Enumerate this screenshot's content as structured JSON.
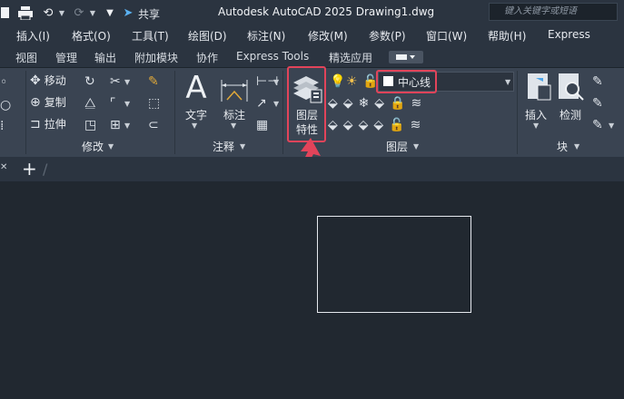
{
  "titlebar": {
    "share_label": "共享",
    "title": "Autodesk AutoCAD 2025    Drawing1.dwg",
    "search_placeholder": "键入关键字或短语"
  },
  "menubar": {
    "items": [
      "插入(I)",
      "格式(O)",
      "工具(T)",
      "绘图(D)",
      "标注(N)",
      "修改(M)",
      "参数(P)",
      "窗口(W)",
      "帮助(H)",
      "Express"
    ]
  },
  "ribbon_tabs": [
    "视图",
    "管理",
    "输出",
    "附加模块",
    "协作",
    "Express Tools",
    "精选应用"
  ],
  "modify_group": {
    "move": "移动",
    "copy": "复制",
    "stretch": "拉伸",
    "title": "修改"
  },
  "annotation_group": {
    "text": "文字",
    "dimension": "标注",
    "title": "注释"
  },
  "layers_group": {
    "layer_props_line1": "图层",
    "layer_props_line2": "特性",
    "current_layer": "中心线",
    "title": "图层"
  },
  "block_group": {
    "insert": "插入",
    "detect": "检测",
    "title": "块"
  },
  "colors": {
    "highlight": "#e2445a",
    "canvas": "#212830",
    "ribbon": "#3a4452"
  }
}
